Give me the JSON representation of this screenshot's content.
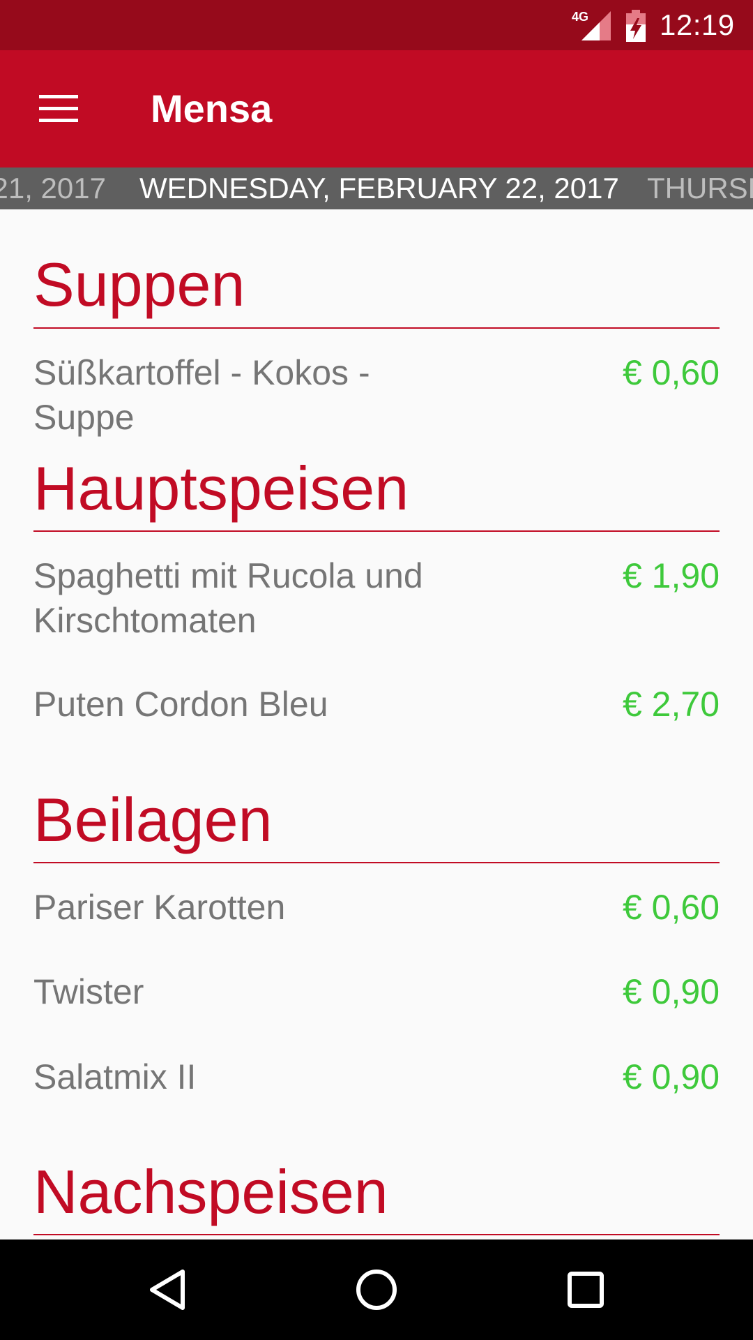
{
  "status_bar": {
    "network": "4G",
    "time": "12:19"
  },
  "app_bar": {
    "title": "Mensa",
    "menu_icon": "hamburger-menu-icon"
  },
  "date_tabs": {
    "previous": "21, 2017",
    "current": "WEDNESDAY, FEBRUARY 22, 2017",
    "next": "THURSD"
  },
  "sections": [
    {
      "title": "Suppen",
      "items": [
        {
          "name": "Süßkartoffel - Kokos - Suppe",
          "price": "€ 0,60"
        }
      ]
    },
    {
      "title": "Hauptspeisen",
      "items": [
        {
          "name": "Spaghetti mit Rucola und Kirschtomaten",
          "price": "€ 1,90"
        },
        {
          "name": "Puten Cordon Bleu",
          "price": "€ 2,70"
        }
      ]
    },
    {
      "title": "Beilagen",
      "items": [
        {
          "name": "Pariser Karotten",
          "price": "€ 0,60"
        },
        {
          "name": "Twister",
          "price": "€ 0,90"
        },
        {
          "name": "Salatmix II",
          "price": "€ 0,90"
        }
      ]
    },
    {
      "title": "Nachspeisen",
      "items": []
    }
  ],
  "colors": {
    "primary": "#c10b24",
    "primary_dark": "#960a1b",
    "tab_bar": "#5f5f5f",
    "price": "#3ec93b",
    "item_text": "#757575"
  },
  "nav_icons": [
    "back-icon",
    "home-icon",
    "recents-icon"
  ]
}
